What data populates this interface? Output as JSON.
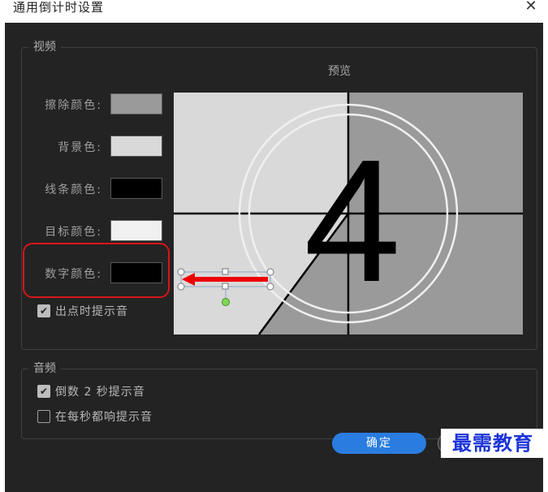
{
  "window": {
    "title": "通用倒计时设置",
    "close_glyph": "✕"
  },
  "video": {
    "legend": "视频",
    "preview_title": "预览",
    "colors": [
      {
        "label": "擦除颜色:",
        "color": "#9a9a9a"
      },
      {
        "label": "背景色:",
        "color": "#d9d9d9"
      },
      {
        "label": "线条颜色:",
        "color": "#000000"
      },
      {
        "label": "目标颜色:",
        "color": "#f0f0f0"
      },
      {
        "label": "数字颜色:",
        "color": "#000000"
      }
    ],
    "cue_at_out": {
      "label": "出点时提示音",
      "checked": true
    },
    "preview_digit": "4"
  },
  "audio": {
    "legend": "音频",
    "two_sec_beep": {
      "label": "倒数 2 秒提示音",
      "checked": true
    },
    "every_sec_beep": {
      "label": "在每秒都响提示音",
      "checked": false
    }
  },
  "buttons": {
    "ok": "确定"
  },
  "watermark": "最需教育",
  "colors": {
    "dialog_bg": "#232323",
    "accent": "#2a7de0",
    "highlight": "#d9141b",
    "arrow": "#ee0000"
  }
}
